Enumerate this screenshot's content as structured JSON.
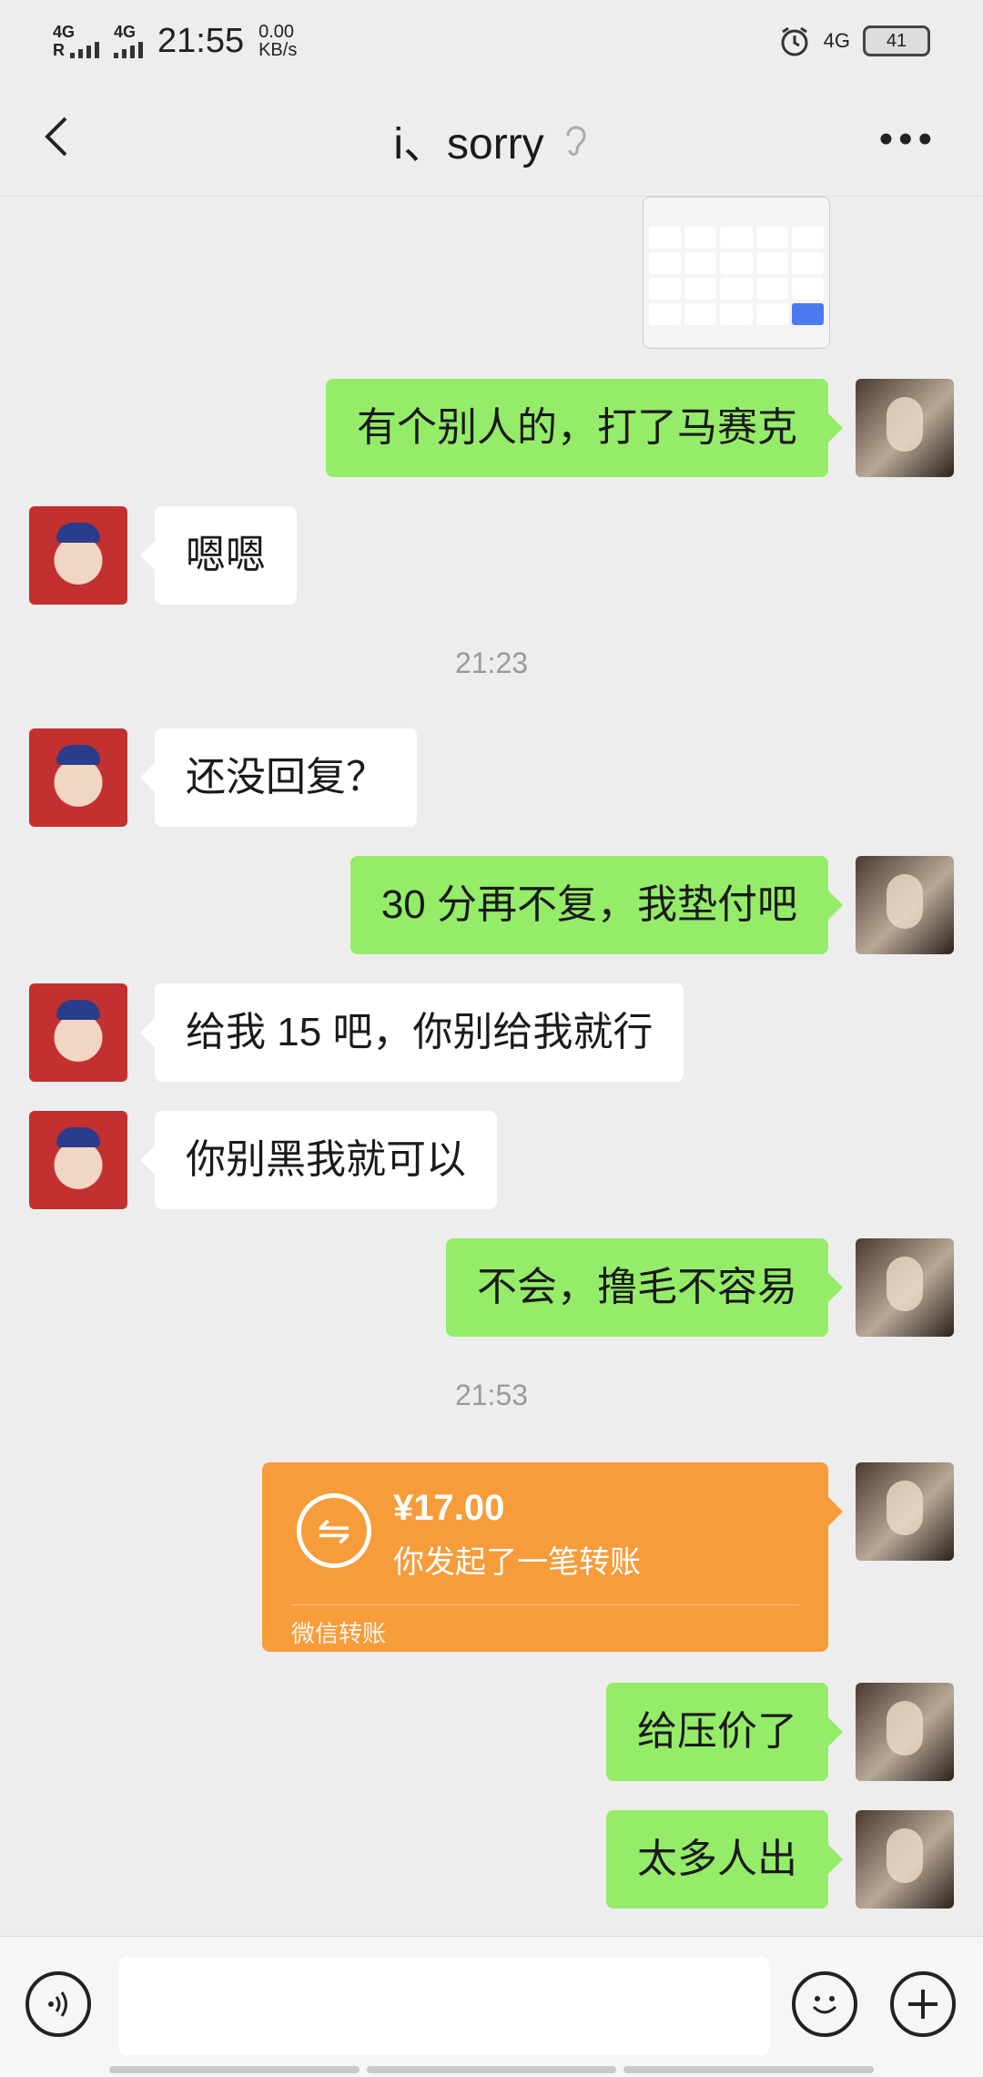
{
  "status_bar": {
    "signal1": "4G",
    "signal1_sub": "R",
    "signal2": "4G",
    "time": "21:55",
    "speed_value": "0.00",
    "speed_unit": "KB/s",
    "network": "4G",
    "battery": "41"
  },
  "header": {
    "title": "i、sorry"
  },
  "messages": {
    "m1": "有个别人的，打了马赛克",
    "m2": "嗯嗯",
    "t1": "21:23",
    "m3": "还没回复？",
    "m4": "30 分再不复，我垫付吧",
    "m5": "给我 15 吧，你别给我就行",
    "m6": "你别黑我就可以",
    "m7": "不会，撸毛不容易",
    "t2": "21:53",
    "m8": "给压价了",
    "m9": "太多人出"
  },
  "transfer": {
    "amount": "¥17.00",
    "description": "你发起了一笔转账",
    "footer": "微信转账"
  },
  "colors": {
    "sent_bubble": "#95ec69",
    "received_bubble": "#ffffff",
    "transfer_card": "#f79c3a",
    "background": "#ededed"
  }
}
